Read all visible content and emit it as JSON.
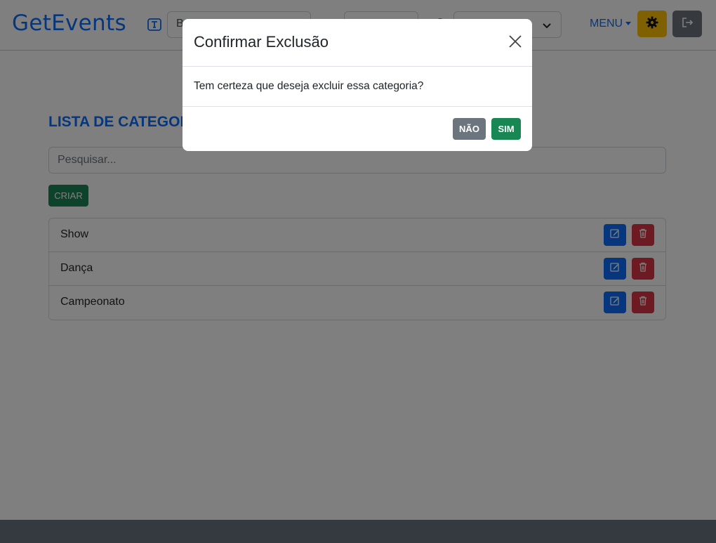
{
  "header": {
    "brand": "GetEvents",
    "field1_text": "B",
    "field2_text": "",
    "field3_text": "r",
    "menu_label": "MENU"
  },
  "main": {
    "title": "LISTA DE CATEGORIAS",
    "search_placeholder": "Pesquisar...",
    "create_label": "CRIAR",
    "items": [
      {
        "label": "Show"
      },
      {
        "label": "Dança"
      },
      {
        "label": "Campeonato"
      }
    ]
  },
  "modal": {
    "title": "Confirmar Exclusão",
    "message": "Tem certeza que deseja excluir essa categoria?",
    "no_label": "NÃO",
    "yes_label": "SIM"
  },
  "icons": {
    "header_search": "form-text-icon",
    "settings": "gear-icon",
    "logout": "logout-icon",
    "edit": "edit-icon",
    "delete": "trash-icon",
    "close": "close-icon"
  },
  "colors": {
    "brand": "#0d6efd",
    "success": "#198754",
    "danger": "#dc3545",
    "warning": "#ffc107",
    "secondary": "#6c757d"
  }
}
